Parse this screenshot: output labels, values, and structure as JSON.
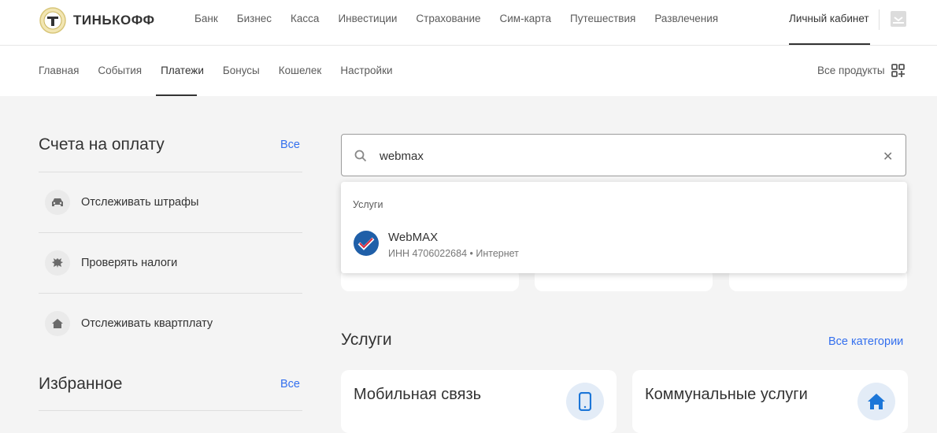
{
  "logo": {
    "text": "ТИНЬКОФФ"
  },
  "top_nav": {
    "items": [
      "Банк",
      "Бизнес",
      "Касса",
      "Инвестиции",
      "Страхование",
      "Сим-карта",
      "Путешествия",
      "Развлечения"
    ],
    "account": "Личный кабинет"
  },
  "sub_nav": {
    "items": [
      "Главная",
      "События",
      "Платежи",
      "Бонусы",
      "Кошелек",
      "Настройки"
    ],
    "active": "Платежи",
    "all_products": "Все продукты"
  },
  "invoices": {
    "title": "Счета на оплату",
    "all": "Все",
    "items": [
      {
        "label": "Отслеживать штрафы",
        "icon": "car-icon"
      },
      {
        "label": "Проверять налоги",
        "icon": "emblem-icon"
      },
      {
        "label": "Отслеживать квартплату",
        "icon": "home-icon"
      }
    ]
  },
  "favorites": {
    "title": "Избранное",
    "all": "Все"
  },
  "search": {
    "value": "webmax",
    "dropdown": {
      "section": "Услуги",
      "result_name": "WebMAX",
      "result_sub": "ИНН 4706022684 • Интернет"
    }
  },
  "services": {
    "title": "Услуги",
    "all": "Все категории",
    "cards": [
      {
        "title": "Мобильная связь",
        "icon": "phone-icon"
      },
      {
        "title": "Коммунальные услуги",
        "icon": "home-icon"
      }
    ]
  },
  "colors": {
    "link": "#336fee",
    "icon_bg": "#e3ecf7",
    "accent": "#1c76d8"
  }
}
